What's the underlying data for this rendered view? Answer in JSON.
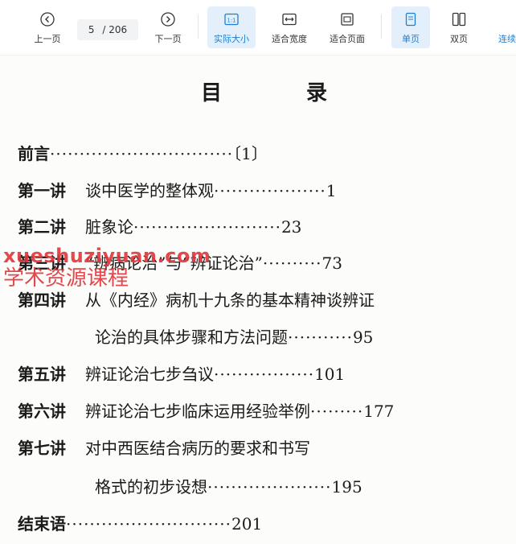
{
  "toolbar": {
    "prev_label": "上一页",
    "current_page": "5",
    "total_pages": "/ 206",
    "next_label": "下一页",
    "actual_size_label": "实际大小",
    "fit_width_label": "适合宽度",
    "fit_page_label": "适合页面",
    "single_page_label": "单页",
    "double_page_label": "双页",
    "continuous_label": "连续",
    "accent_color": "#1a7fd6"
  },
  "document": {
    "title": "目  录",
    "entries": [
      {
        "chapter": "前言",
        "title": "",
        "dots": "·······························",
        "page": "〔1〕"
      },
      {
        "chapter": "第一讲",
        "title": "谈中医学的整体观",
        "dots": "···················",
        "page": "1"
      },
      {
        "chapter": "第二讲",
        "title": "脏象论",
        "dots": "·························",
        "page": "23"
      },
      {
        "chapter": "第三讲",
        "title": "“辨病论治”与“辨证论治”",
        "dots": "··········",
        "page": "73"
      },
      {
        "chapter": "第四讲",
        "title": "从《内经》病机十九条的基本精神谈辨证",
        "dots": "",
        "page": ""
      },
      {
        "chapter": "",
        "title": "论治的具体步骤和方法问题",
        "dots": "···········",
        "page": "95"
      },
      {
        "chapter": "第五讲",
        "title": "辨证论治七步刍议",
        "dots": "·················",
        "page": "101"
      },
      {
        "chapter": "第六讲",
        "title": "辨证论治七步临床运用经验举例",
        "dots": "·········",
        "page": "177"
      },
      {
        "chapter": "第七讲",
        "title": "对中西医结合病历的要求和书写",
        "dots": "",
        "page": ""
      },
      {
        "chapter": "",
        "title": "格式的初步设想",
        "dots": "·····················",
        "page": "195"
      },
      {
        "chapter": "结束语",
        "title": "",
        "dots": "····························",
        "page": "201"
      }
    ]
  },
  "watermark": {
    "line1": "xueshuziyuan.com",
    "line2": "学术资源课程",
    "color": "#e0353a"
  }
}
